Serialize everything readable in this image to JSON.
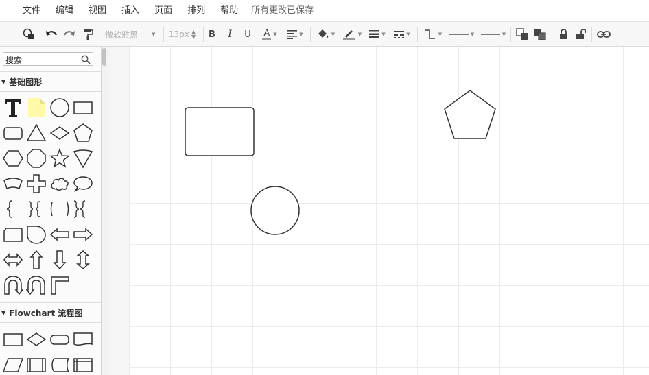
{
  "menubar": {
    "items": [
      "文件",
      "编辑",
      "视图",
      "插入",
      "页面",
      "排列",
      "帮助"
    ],
    "status": "所有更改已保存"
  },
  "toolbar": {
    "font_family": "微软雅黑",
    "font_size": "13px",
    "icons": [
      "format-panel-icon",
      "undo-icon",
      "redo-icon",
      "format-painter-icon",
      "bold-icon",
      "italic-icon",
      "underline-icon",
      "font-color-icon",
      "align-icon",
      "fill-color-icon",
      "line-color-icon",
      "line-width-icon",
      "line-dash-icon",
      "connector-style-icon",
      "line-start-icon",
      "line-end-icon",
      "to-front-icon",
      "to-back-icon",
      "lock-icon",
      "unlock-icon",
      "link-icon"
    ]
  },
  "sidebar": {
    "search_placeholder": "搜索",
    "sections": [
      {
        "title": "基础图形",
        "shapes": [
          "text",
          "note",
          "circle",
          "rectangle",
          "rounded-rectangle",
          "triangle",
          "diamond",
          "pentagon",
          "hexagon",
          "octagon",
          "star",
          "inverted-pentagon",
          "curved-banner",
          "cross",
          "cloud",
          "speech-bubble",
          "left-brace",
          "brace-pair",
          "bracket-pair",
          "right-brace",
          "tape",
          "half-circle",
          "arrow-left",
          "arrow-right",
          "arrow-left-right",
          "arrow-up",
          "arrow-down",
          "arrow-up-down",
          "u-turn-arrow",
          "u-turn-arrow-2",
          "corner-shape"
        ]
      },
      {
        "title": "Flowchart 流程图",
        "shapes": [
          "process",
          "decision",
          "terminator",
          "document",
          "data",
          "predefined-process",
          "stored-data",
          "internal-storage"
        ]
      }
    ]
  },
  "canvas": {
    "shapes": [
      "rounded-rectangle",
      "circle",
      "pentagon"
    ],
    "stroke_color": "#333333"
  }
}
